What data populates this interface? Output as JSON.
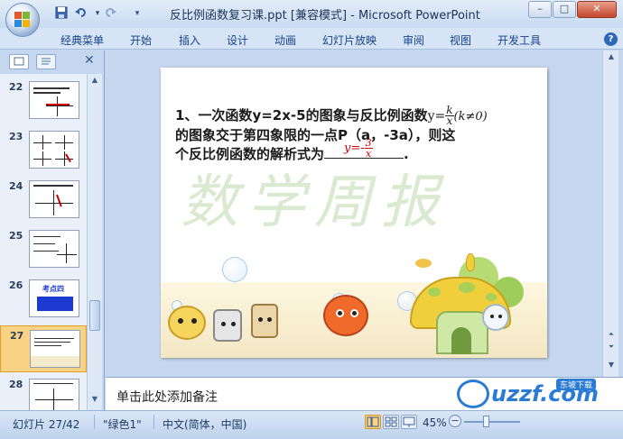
{
  "window": {
    "title": "反比例函数复习课.ppt [兼容模式] - Microsoft PowerPoint"
  },
  "quick_access": {
    "save_icon": "save-icon",
    "undo_icon": "undo-icon",
    "redo_icon": "redo-icon",
    "customize_icon": "chevron-down-icon"
  },
  "window_controls": {
    "minimize": "–",
    "maximize": "□",
    "close": "✕"
  },
  "ribbon": {
    "tabs": [
      "经典菜单",
      "开始",
      "插入",
      "设计",
      "动画",
      "幻灯片放映",
      "审阅",
      "视图",
      "开发工具"
    ],
    "help": "?"
  },
  "panel": {
    "close": "✕",
    "thumbnails": [
      {
        "num": "22"
      },
      {
        "num": "23"
      },
      {
        "num": "24"
      },
      {
        "num": "25"
      },
      {
        "num": "26",
        "text": "考点四"
      },
      {
        "num": "27"
      },
      {
        "num": "28"
      }
    ],
    "selected_index": 5
  },
  "slide": {
    "line1_prefix": "1、一次函数",
    "line1_eq": "y=2x-5",
    "line1_mid": "的图象与反比例函数",
    "line1_y": "y=",
    "line1_frac_num": "k",
    "line1_frac_den": "x",
    "line1_cond": "(k≠0)",
    "line2": "的图象交于第四象限的一点P（a，-3a），则这",
    "line3_prefix": "个反比例函数的解析式为",
    "line3_end": ".",
    "answer_prefix": "y=-",
    "answer_num": "3",
    "answer_den": "x",
    "watermark": "数学周报"
  },
  "notes": {
    "placeholder": "单击此处添加备注"
  },
  "brand": {
    "text": "uzzf.com",
    "badge": "东坡下载"
  },
  "status_bar": {
    "slide_info": "幻灯片 27/42",
    "theme": "\"绿色1\"",
    "language": "中文(简体，中国)",
    "zoom": "45%"
  },
  "colors": {
    "accent": "#15428b",
    "answer_red": "#cc0000",
    "selection": "#f9d283"
  }
}
